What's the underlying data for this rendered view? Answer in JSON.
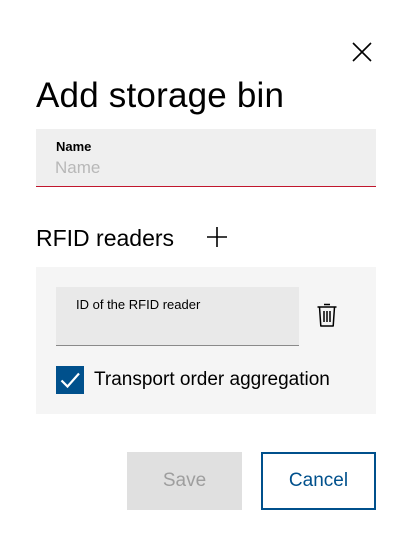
{
  "dialog": {
    "title": "Add storage bin",
    "close_icon": "close-icon"
  },
  "name_field": {
    "label": "Name",
    "placeholder": "Name",
    "value": ""
  },
  "rfid_section": {
    "heading": "RFID readers",
    "add_icon": "plus-icon",
    "readers": [
      {
        "label": "ID of the RFID reader",
        "value": "",
        "delete_icon": "trash-icon"
      }
    ],
    "transport_order_aggregation": {
      "label": "Transport order aggregation",
      "checked": true
    }
  },
  "actions": {
    "save_label": "Save",
    "cancel_label": "Cancel"
  },
  "colors": {
    "accent": "#00508c",
    "error_underline": "#c0162d",
    "field_bg": "#efefef",
    "panel_bg": "#f5f5f5",
    "disabled_bg": "#e0e0e0",
    "disabled_text": "#9e9e9e"
  }
}
